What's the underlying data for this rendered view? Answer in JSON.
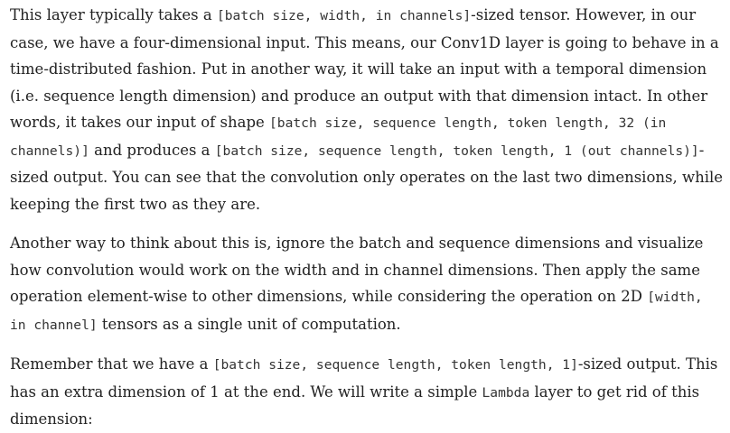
{
  "paragraphs": [
    {
      "segments": [
        {
          "type": "text",
          "text": "This layer typically takes a "
        },
        {
          "type": "code",
          "text": "[batch size, width, in channels]"
        },
        {
          "type": "text",
          "text": "-sized tensor. However, in our case, we have a four-dimensional input. This means, our Conv1D layer is going to behave in a time-distributed fashion. Put in another way, it will take an input with a temporal dimension (i.e. sequence length dimension) and produce an output with that dimension intact. In other words, it takes our input of shape "
        },
        {
          "type": "code",
          "text": "[batch size, sequence length, token length, 32 (in channels)]"
        },
        {
          "type": "text",
          "text": " and produces a "
        },
        {
          "type": "code",
          "text": "[batch size, sequence length, token length, 1 (out channels)]"
        },
        {
          "type": "text",
          "text": "-sized output. You can see that the convolution only operates on the last two dimensions, while keeping the first two as they are."
        }
      ]
    },
    {
      "segments": [
        {
          "type": "text",
          "text": "Another way to think about this is, ignore the batch and sequence dimensions and visualize how convolution would work on the width and in channel dimensions. Then apply the same operation element-wise to other dimensions, while considering the operation on 2D "
        },
        {
          "type": "code",
          "text": "[width, in channel]"
        },
        {
          "type": "text",
          "text": " tensors as a single unit of computation."
        }
      ]
    },
    {
      "segments": [
        {
          "type": "text",
          "text": "Remember that we have a "
        },
        {
          "type": "code",
          "text": "[batch size, sequence length, token length, 1]"
        },
        {
          "type": "text",
          "text": "-sized output. This has an extra dimension of 1 at the end. We will write a simple "
        },
        {
          "type": "code",
          "text": "Lambda"
        },
        {
          "type": "text",
          "text": " layer to get rid of this dimension:"
        }
      ]
    }
  ]
}
